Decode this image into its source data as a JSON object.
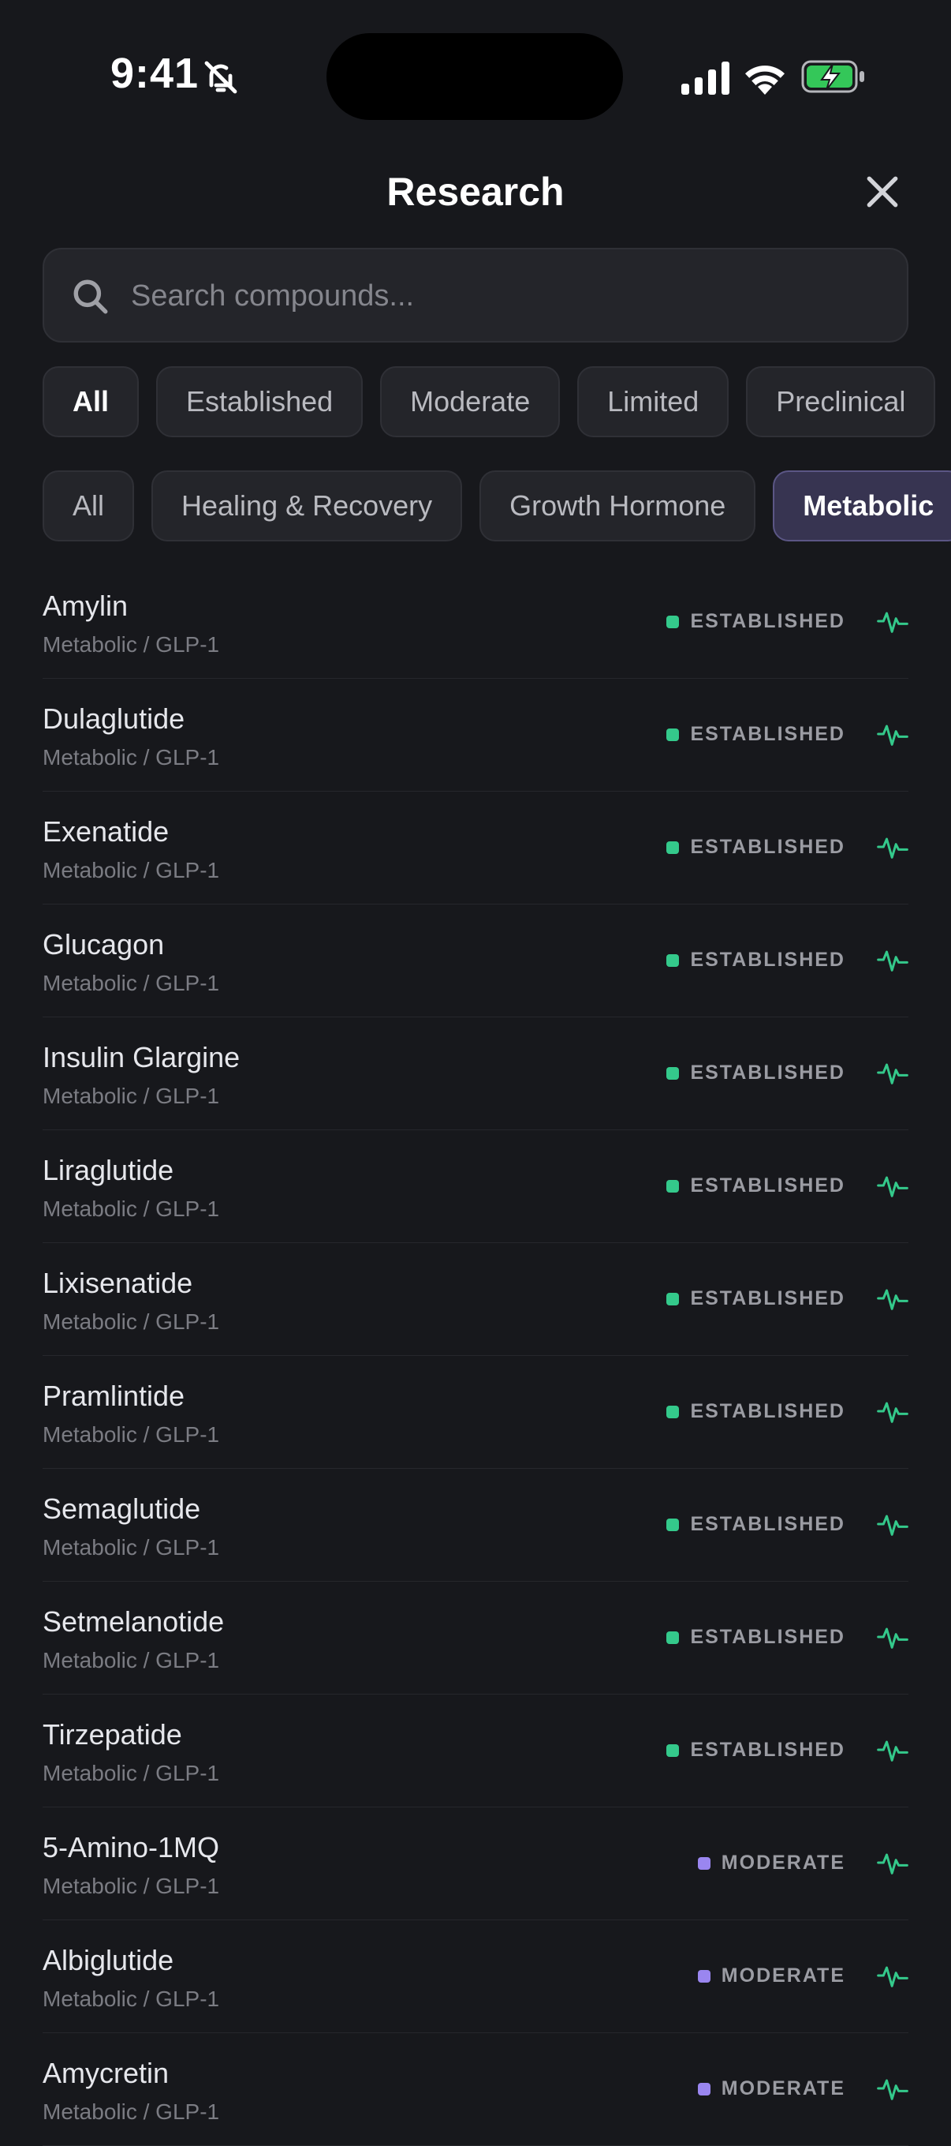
{
  "status_bar": {
    "time": "9:41"
  },
  "header": {
    "title": "Research"
  },
  "search": {
    "placeholder": "Search compounds..."
  },
  "evidence_filters": [
    "All",
    "Established",
    "Moderate",
    "Limited",
    "Preclinical"
  ],
  "category_filters": [
    "All",
    "Healing & Recovery",
    "Growth Hormone",
    "Metabolic"
  ],
  "selected_category": "Metabolic",
  "colors": {
    "established": "#34c98b",
    "moderate": "#9a86f0",
    "pulse": "#34c98b",
    "accent": "#5b5685"
  },
  "compounds": [
    {
      "name": "Amylin",
      "category": "Metabolic / GLP-1",
      "evidence": "ESTABLISHED"
    },
    {
      "name": "Dulaglutide",
      "category": "Metabolic / GLP-1",
      "evidence": "ESTABLISHED"
    },
    {
      "name": "Exenatide",
      "category": "Metabolic / GLP-1",
      "evidence": "ESTABLISHED"
    },
    {
      "name": "Glucagon",
      "category": "Metabolic / GLP-1",
      "evidence": "ESTABLISHED"
    },
    {
      "name": "Insulin Glargine",
      "category": "Metabolic / GLP-1",
      "evidence": "ESTABLISHED"
    },
    {
      "name": "Liraglutide",
      "category": "Metabolic / GLP-1",
      "evidence": "ESTABLISHED"
    },
    {
      "name": "Lixisenatide",
      "category": "Metabolic / GLP-1",
      "evidence": "ESTABLISHED"
    },
    {
      "name": "Pramlintide",
      "category": "Metabolic / GLP-1",
      "evidence": "ESTABLISHED"
    },
    {
      "name": "Semaglutide",
      "category": "Metabolic / GLP-1",
      "evidence": "ESTABLISHED"
    },
    {
      "name": "Setmelanotide",
      "category": "Metabolic / GLP-1",
      "evidence": "ESTABLISHED"
    },
    {
      "name": "Tirzepatide",
      "category": "Metabolic / GLP-1",
      "evidence": "ESTABLISHED"
    },
    {
      "name": "5-Amino-1MQ",
      "category": "Metabolic / GLP-1",
      "evidence": "MODERATE"
    },
    {
      "name": "Albiglutide",
      "category": "Metabolic / GLP-1",
      "evidence": "MODERATE"
    },
    {
      "name": "Amycretin",
      "category": "Metabolic / GLP-1",
      "evidence": "MODERATE"
    }
  ]
}
